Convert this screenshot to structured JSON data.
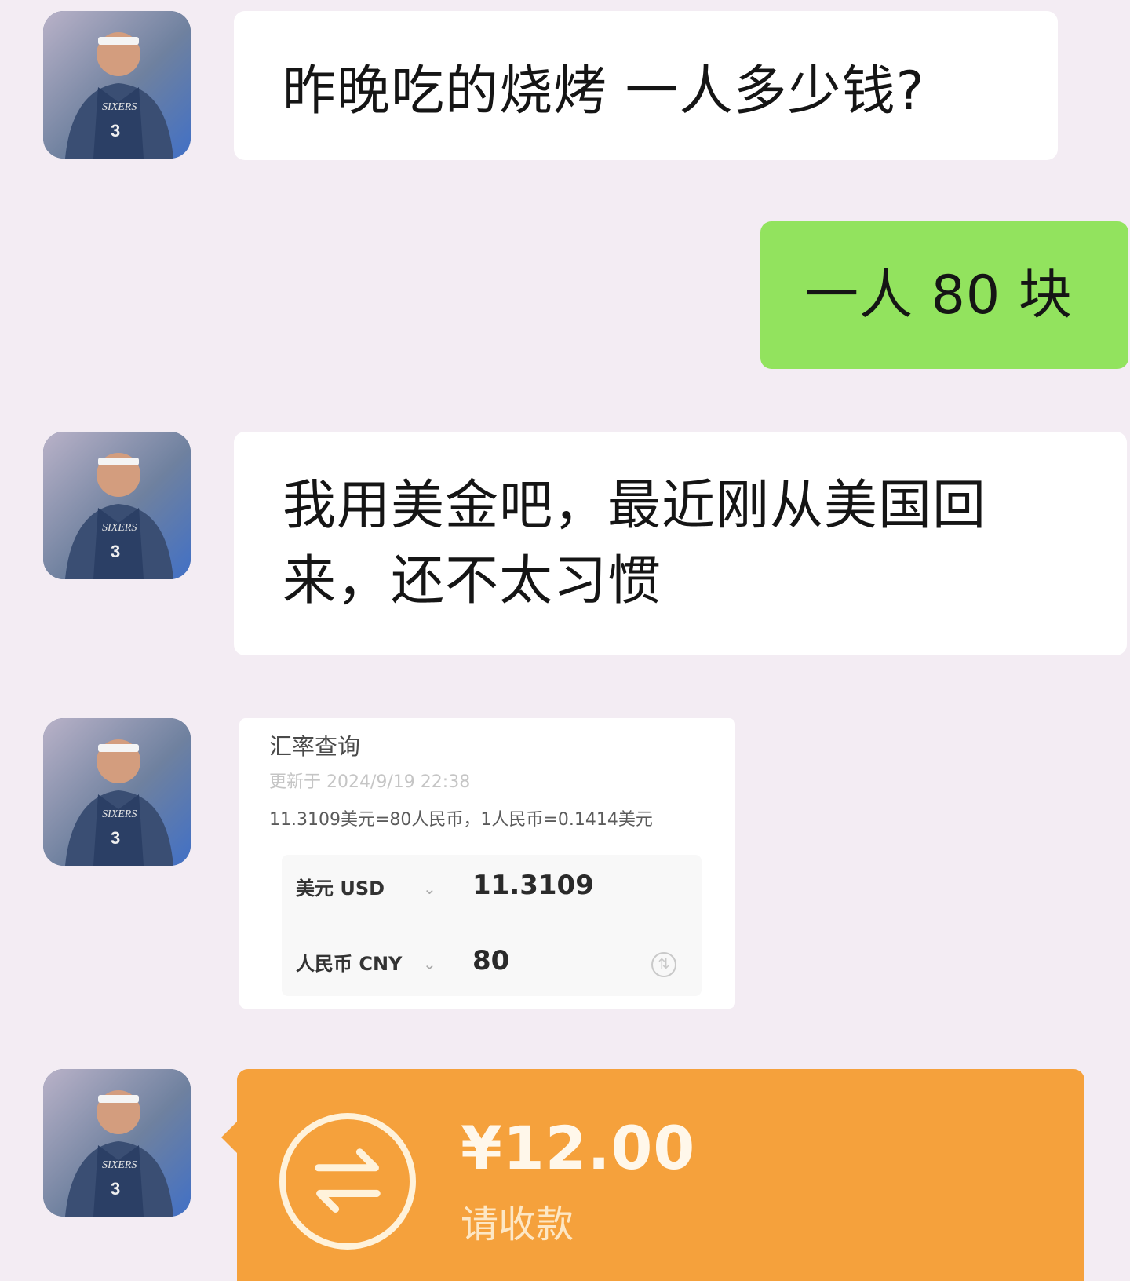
{
  "chat": {
    "messages": [
      {
        "direction": "incoming",
        "type": "text",
        "text": "昨晚吃的烧烤 一人多少钱?"
      },
      {
        "direction": "outgoing",
        "type": "text",
        "text": "一人 80 块"
      },
      {
        "direction": "incoming",
        "type": "text",
        "text": "我用美金吧，最近刚从美国回来，还不太习惯"
      },
      {
        "direction": "incoming",
        "type": "exchange-card",
        "title": "汇率查询",
        "updated": "更新于 2024/9/19 22:38",
        "rate": "11.3109美元=80人民币，1人民币=0.1414美元",
        "rows": [
          {
            "currency": "美元 USD",
            "value": "11.3109"
          },
          {
            "currency": "人民币 CNY",
            "value": "80"
          }
        ]
      },
      {
        "direction": "incoming",
        "type": "transfer",
        "amount": "¥12.00",
        "label": "请收款"
      }
    ]
  },
  "icons": {
    "avatar": "player-avatar",
    "dropdown": "chevron-down-icon",
    "swap": "swap-icon",
    "transfer": "transfer-icon"
  },
  "colors": {
    "background": "#f3ecf3",
    "incoming_bubble": "#ffffff",
    "outgoing_bubble": "#92e35e",
    "transfer_card": "#f5a13c"
  }
}
